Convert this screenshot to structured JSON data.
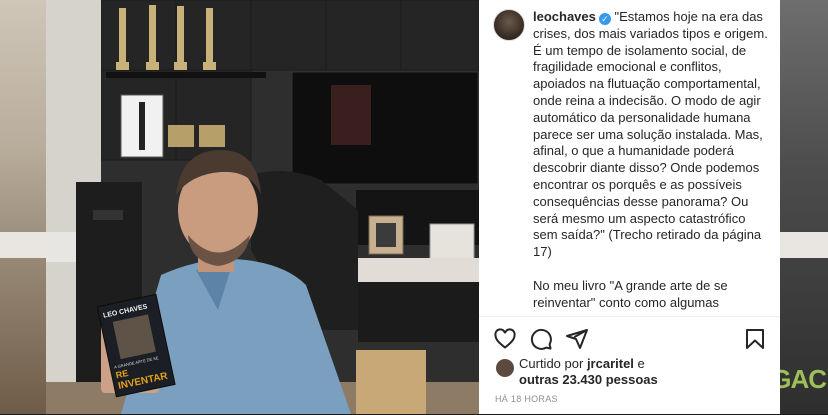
{
  "post": {
    "username": "leochaves",
    "caption": "\"Estamos hoje na era das crises, dos mais variados tipos e origem. É um tempo de isolamento social, de fragilidade emocional e conflitos, apoiados na flutuação comportamental, onde reina a indecisão. O modo de agir automático da personalidade humana parece ser uma solução instalada. Mas, afinal, o que a humanidade poderá descobrir diante disso? Onde podemos encontrar os porquês e as possíveis consequências desse panorama? Ou será mesmo um aspecto catastrófico sem saída?\" (Trecho retirado da página 17)\n\nNo meu livro \"A grande arte de se reinventar\" conto como algumas",
    "book": {
      "author": "LEO CHAVES",
      "title_line1": "A GRANDE ARTE DE SE",
      "title_line2": "RE",
      "title_line3": "INVENTAR"
    },
    "liked_by_prefix": "Curtido por",
    "liked_by_user": "jrcaritel",
    "liked_by_joiner": "e",
    "liked_by_others": "outras 23.430 pessoas",
    "timestamp": "HÁ 18 HORAS"
  },
  "background": {
    "right_text": "GAC"
  },
  "icons": [
    "verified-badge-icon",
    "heart-icon",
    "comment-icon",
    "share-icon",
    "bookmark-icon"
  ]
}
